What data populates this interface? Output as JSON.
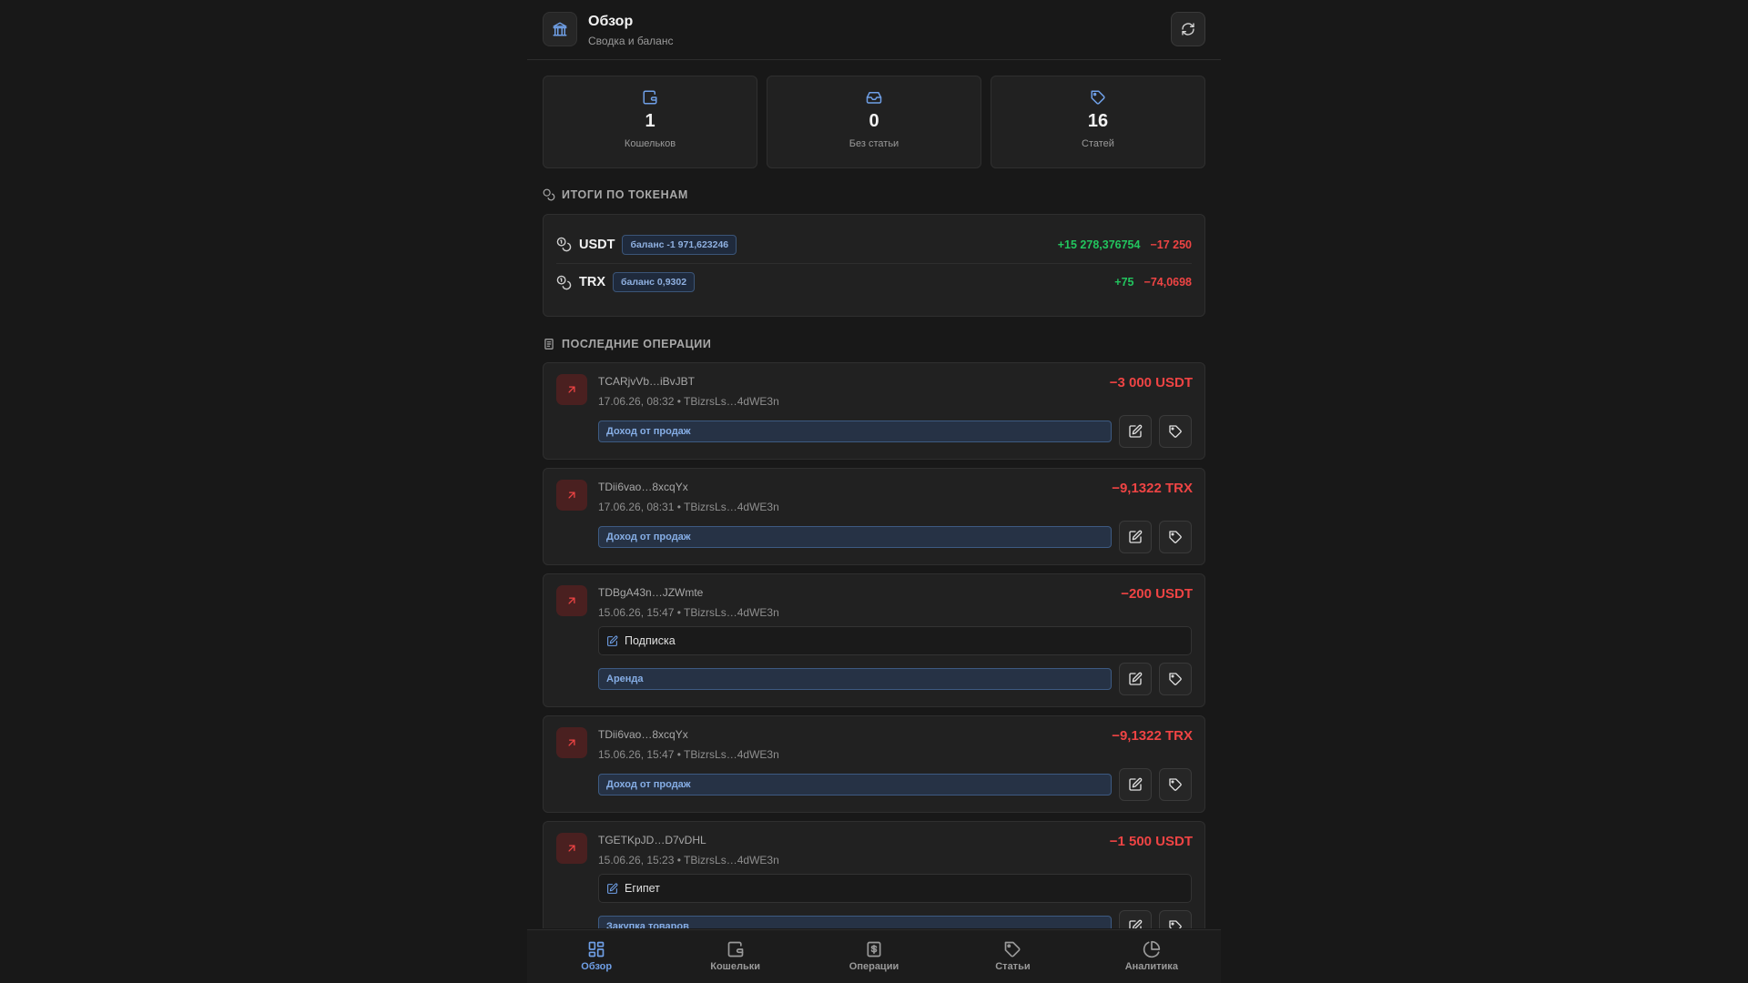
{
  "header": {
    "title": "Обзор",
    "subtitle": "Сводка и баланс",
    "icon": "bank-icon"
  },
  "stats": [
    {
      "value": "1",
      "label": "Кошельков",
      "icon": "wallet-icon"
    },
    {
      "value": "0",
      "label": "Без статьи",
      "icon": "inbox-icon"
    },
    {
      "value": "16",
      "label": "Статей",
      "icon": "tag-icon"
    }
  ],
  "tokens_section": {
    "title": "ИТОГИ ПО ТОКЕНАМ"
  },
  "tokens": [
    {
      "name": "USDT",
      "badge": "баланс -1 971,623246",
      "income": "+15 278,376754",
      "expense": "−17 250"
    },
    {
      "name": "TRX",
      "badge": "баланс 0,9302",
      "income": "+75",
      "expense": "−74,0698"
    }
  ],
  "ops_section": {
    "title": "ПОСЛЕДНИЕ ОПЕРАЦИИ"
  },
  "operations": [
    {
      "hash": "TCARjvVb…iBvJBT",
      "meta": "17.06.26, 08:32 • TBizrsLs…4dWE3n",
      "amount": "−3 000 USDT",
      "note": "",
      "category": "Доход от продаж"
    },
    {
      "hash": "TDii6vao…8xcqYx",
      "meta": "17.06.26, 08:31 • TBizrsLs…4dWE3n",
      "amount": "−9,1322 TRX",
      "note": "",
      "category": "Доход от продаж"
    },
    {
      "hash": "TDBgA43n…JZWmte",
      "meta": "15.06.26, 15:47 • TBizrsLs…4dWE3n",
      "amount": "−200 USDT",
      "note": "Подписка",
      "category": "Аренда"
    },
    {
      "hash": "TDii6vao…8xcqYx",
      "meta": "15.06.26, 15:47 • TBizrsLs…4dWE3n",
      "amount": "−9,1322 TRX",
      "note": "",
      "category": "Доход от продаж"
    },
    {
      "hash": "TGETKpJD…D7vDHL",
      "meta": "15.06.26, 15:23 • TBizrsLs…4dWE3n",
      "amount": "−1 500 USDT",
      "note": "Египет",
      "category": "Закупка товаров"
    }
  ],
  "nav": [
    {
      "label": "Обзор",
      "icon": "dashboard-icon",
      "active": true
    },
    {
      "label": "Кошельки",
      "icon": "wallet-icon",
      "active": false
    },
    {
      "label": "Операции",
      "icon": "receipt-icon",
      "active": false
    },
    {
      "label": "Статьи",
      "icon": "tag-icon",
      "active": false
    },
    {
      "label": "Аналитика",
      "icon": "pie-chart-icon",
      "active": false
    }
  ],
  "colors": {
    "accent": "#6f9fe6",
    "income": "#22c55e",
    "expense": "#ef4444",
    "background": "#181818",
    "card": "#212121"
  }
}
